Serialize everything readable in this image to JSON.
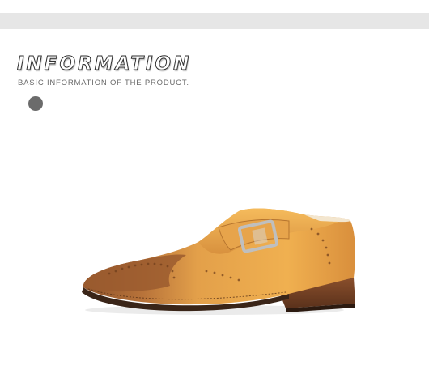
{
  "header": {
    "title": "INFORMATION",
    "subtitle": "BASIC INFORMATION OF THE PRODUCT."
  },
  "product_image": {
    "subject": "shoe-image"
  },
  "colors": {
    "band": "#e6e6e6",
    "dot": "#6b6b6b",
    "leather": "#e9a84a",
    "toe": "#9b5c2f",
    "heel": "#6b3a22",
    "sole": "#3a2518",
    "buckle": "#c9c9c9"
  }
}
